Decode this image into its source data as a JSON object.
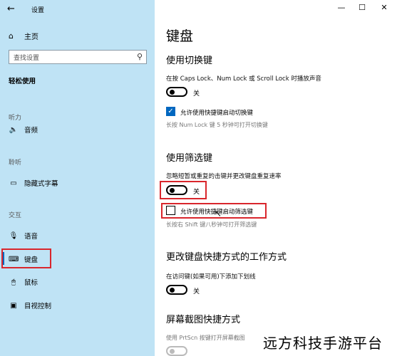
{
  "window": {
    "title": "设置",
    "controls": [
      "—",
      "☐",
      "✕"
    ]
  },
  "sidebar": {
    "home": "主页",
    "search_placeholder": "查找设置",
    "section": "轻松使用",
    "groups": {
      "hearing": "听力",
      "hearing_items": [
        "音频",
        "隐藏式字幕"
      ],
      "hearing_group2": "聆听",
      "interaction": "交互",
      "interaction_items": [
        "语音",
        "键盘",
        "鼠标",
        "目视控制"
      ]
    }
  },
  "main": {
    "title": "键盘",
    "toggle_keys": {
      "heading": "使用切换键",
      "desc": "在按 Caps Lock、Num Lock 或 Scroll Lock 时播放声音",
      "toggle_state": "关",
      "shortcut_label": "允许使用快捷键启动切换键",
      "shortcut_checked": true,
      "shortcut_hint": "长按 Num Lock 键 5 秒钟可打开切换键"
    },
    "filter_keys": {
      "heading": "使用筛选键",
      "desc": "忽略短暂或重复的击键并更改键盘重复速率",
      "toggle_state": "关",
      "shortcut_label": "允许使用快捷键启动筛选键",
      "shortcut_checked": false,
      "shortcut_hint": "长按右 Shift 键八秒钟可打开筛选键"
    },
    "shortcut_behavior": {
      "heading": "更改键盘快捷方式的工作方式",
      "desc": "在访问键(如果可用)下添加下划线",
      "toggle_state": "关"
    },
    "screenshot": {
      "heading": "屏幕截图快捷方式",
      "desc": "使用 PrtScn 按键打开屏幕截图"
    }
  },
  "watermark": "远方科技手游平台"
}
